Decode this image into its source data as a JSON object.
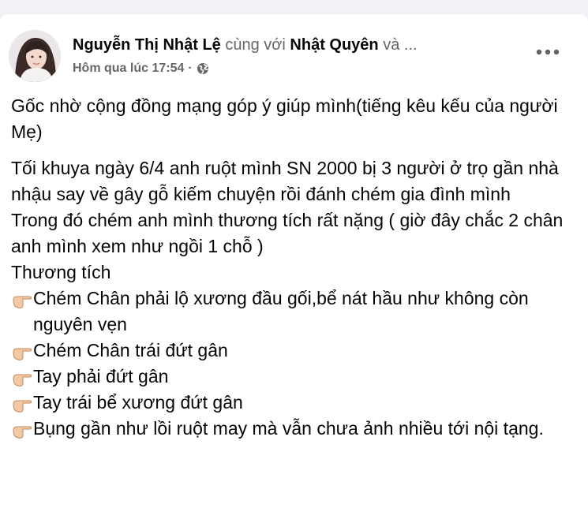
{
  "post": {
    "author_name": "Nguyễn Thị Nhật Lệ",
    "with_text": "cùng với",
    "tagged_name": "Nhật Quyên",
    "and_more": "và ...",
    "timestamp": "Hôm qua lúc 17:54",
    "separator": "·",
    "privacy_icon": "globe-icon",
    "more_icon": "more-options-icon",
    "paragraph_1": "Gốc nhờ cộng đồng mạng góp ý giúp mình(tiếng kêu kếu của người Mẹ)",
    "paragraph_2": "Tối khuya ngày 6/4 anh ruột mình SN 2000 bị 3 người ở trọ gần nhà nhậu say về gây gỗ kiếm chuyện rồi đánh chém gia đình mình",
    "paragraph_3": "Trong đó chém anh mình thương tích rất nặng ( giờ đây chắc 2 chân anh mình xem như ngồi 1 chỗ )",
    "injuries_heading": "Thương tích",
    "bullet_icon": "pointing-hand-emoji",
    "injuries": [
      "Chém Chân phải lộ xương đầu gối,bể nát hầu như không còn nguyên vẹn",
      "Chém Chân trái đứt gân",
      "Tay phải đứt gân",
      "Tay trái bể xương đứt gân",
      "Bụng gần như lồi ruột may mà vẫn chưa ảnh nhiều tới nội tạng."
    ]
  }
}
